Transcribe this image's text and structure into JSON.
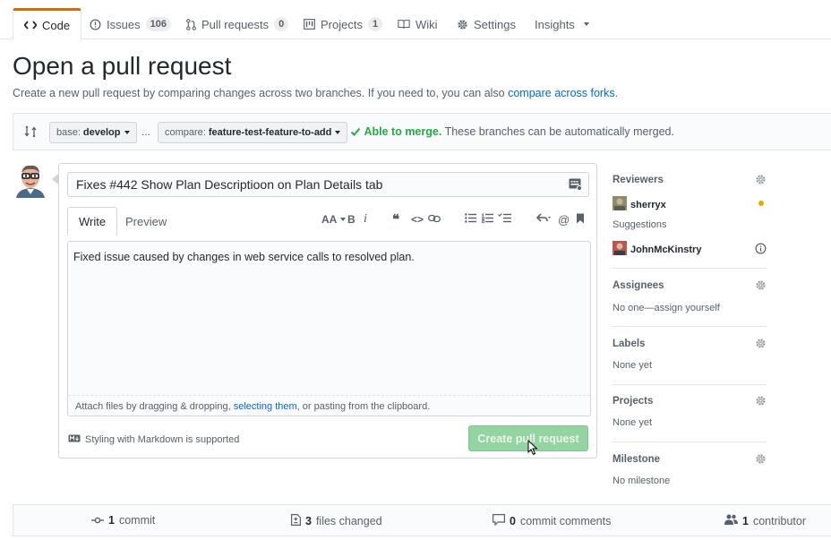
{
  "tabs": [
    {
      "label": "Code",
      "icon": "code-icon"
    },
    {
      "label": "Issues",
      "count": "106",
      "icon": "issue-icon"
    },
    {
      "label": "Pull requests",
      "count": "0",
      "icon": "pull-request-icon"
    },
    {
      "label": "Projects",
      "count": "1",
      "icon": "project-icon"
    },
    {
      "label": "Wiki",
      "icon": "book-icon"
    },
    {
      "label": "Settings",
      "icon": "gear-icon"
    },
    {
      "label": "Insights",
      "icon": "dropdown-caret"
    }
  ],
  "page": {
    "title": "Open a pull request",
    "subtitle": "Create a new pull request by comparing changes across two branches. If you need to, you can also ",
    "subtitle_link": "compare across forks",
    "subtitle_end": "."
  },
  "range": {
    "base_prefix": "base:",
    "base_branch": "develop",
    "ellipsis": "...",
    "compare_prefix": "compare:",
    "compare_branch": "feature-test-feature-to-add",
    "merge_ok": "Able to merge.",
    "merge_note": "These branches can be automatically merged."
  },
  "compose": {
    "title_value": "Fixes #442 Show Plan Descriptioon on Plan Details tab",
    "tab_write": "Write",
    "tab_preview": "Preview",
    "body": "Fixed issue caused by changes in web service calls to resolved plan.",
    "attach_text_1": "Attach files by dragging & dropping, ",
    "attach_link": "selecting them",
    "attach_text_2": ", or pasting from the clipboard.",
    "markdown_note": "Styling with Markdown is supported",
    "create_button": "Create pull request"
  },
  "toolbar": {
    "heading": "AA",
    "bold": "B",
    "italic": "i",
    "quote": "❝",
    "code": "<>",
    "mention": "@"
  },
  "sidebar": {
    "reviewers": {
      "heading": "Reviewers",
      "reviewer": "sherryx",
      "suggestions_label": "Suggestions",
      "suggested": "JohnMcKinstry"
    },
    "assignees": {
      "heading": "Assignees",
      "value": "No one—assign yourself"
    },
    "labels": {
      "heading": "Labels",
      "value": "None yet"
    },
    "projects": {
      "heading": "Projects",
      "value": "None yet"
    },
    "milestone": {
      "heading": "Milestone",
      "value": "No milestone"
    }
  },
  "footer": {
    "commits_count": "1",
    "commits_label": "commit",
    "files_count": "3",
    "files_label": "files changed",
    "comments_count": "0",
    "comments_label": "commit comments",
    "contrib_count": "1",
    "contrib_label": "contributor"
  },
  "colors": {
    "accent_tab": "#e36209",
    "link": "#0366d6",
    "merge_ok": "#28a745",
    "create_button": "#94d3a2",
    "pending_review_dot": "#dbab09"
  }
}
